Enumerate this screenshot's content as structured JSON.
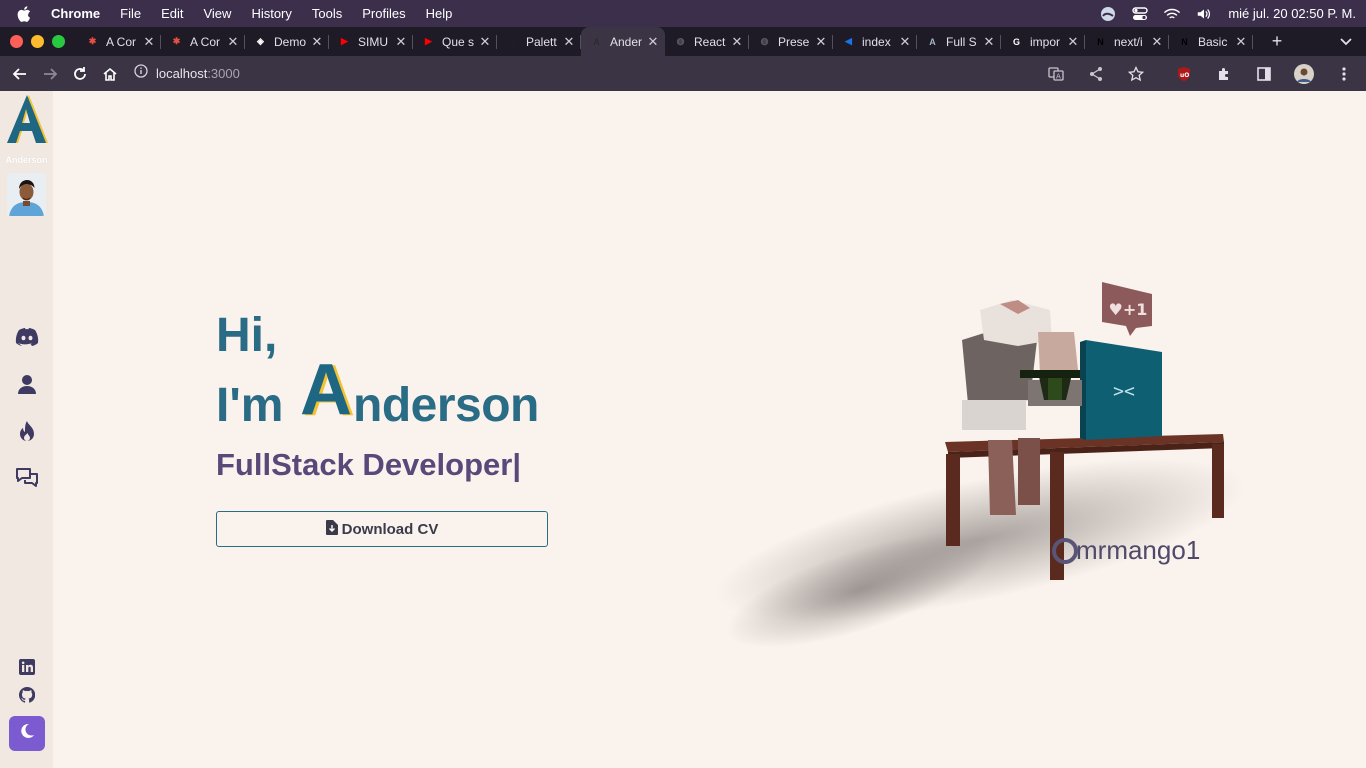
{
  "menubar": {
    "app_name": "Chrome",
    "items": [
      "File",
      "Edit",
      "View",
      "History",
      "Tools",
      "Profiles",
      "Help"
    ],
    "clock": "mié jul. 20  02:50 P. M."
  },
  "tabs": [
    {
      "title": "A Cor",
      "favicon_color": "#e8513f",
      "favicon_glyph": "✱"
    },
    {
      "title": "A Cor",
      "favicon_color": "#e8513f",
      "favicon_glyph": "✱"
    },
    {
      "title": "Demo",
      "favicon_color": "#ffffff",
      "favicon_glyph": "◈"
    },
    {
      "title": "SIMU",
      "favicon_color": "#ff0000",
      "favicon_glyph": "▶"
    },
    {
      "title": "Que s",
      "favicon_color": "#ff0000",
      "favicon_glyph": "▶"
    },
    {
      "title": "Palett",
      "favicon_color": "#1d1d2b",
      "favicon_glyph": "●"
    },
    {
      "title": "Ander",
      "favicon_color": "#2b2b2b",
      "favicon_glyph": "A"
    },
    {
      "title": "React",
      "favicon_color": "#5b5b66",
      "favicon_glyph": "◍"
    },
    {
      "title": "Prese",
      "favicon_color": "#5b5b66",
      "favicon_glyph": "◍"
    },
    {
      "title": "index",
      "favicon_color": "#1a73e8",
      "favicon_glyph": "◀"
    },
    {
      "title": "Full S",
      "favicon_color": "#9fb8c8",
      "favicon_glyph": "A"
    },
    {
      "title": "impor",
      "favicon_color": "#ffffff",
      "favicon_glyph": "G"
    },
    {
      "title": "next/i",
      "favicon_color": "#000000",
      "favicon_glyph": "N"
    },
    {
      "title": "Basic",
      "favicon_color": "#000000",
      "favicon_glyph": "N"
    }
  ],
  "active_tab_index": 6,
  "omnibox": {
    "host": "localhost",
    "port": ":3000"
  },
  "sidebar": {
    "logo_name": "Anderson",
    "nav_icons": [
      "discord-icon",
      "user-icon",
      "fire-icon",
      "chat-icon"
    ],
    "social_icons": [
      "linkedin-icon",
      "github-icon"
    ],
    "theme_icon": "moon-icon"
  },
  "hero": {
    "greeting": "Hi,",
    "im": "I'm",
    "name_initial": "A",
    "name_rest": "nderson",
    "role": "FullStack Developer|",
    "cv_button": "Download CV"
  },
  "illustration": {
    "bubble_text": "♥+1",
    "credit": "mrmango1"
  },
  "colors": {
    "heading": "#2a6b85",
    "role": "#574a7a",
    "accent_yellow": "#f2c230",
    "theme_button": "#7c5bd0",
    "page_bg": "#faf3ed"
  }
}
